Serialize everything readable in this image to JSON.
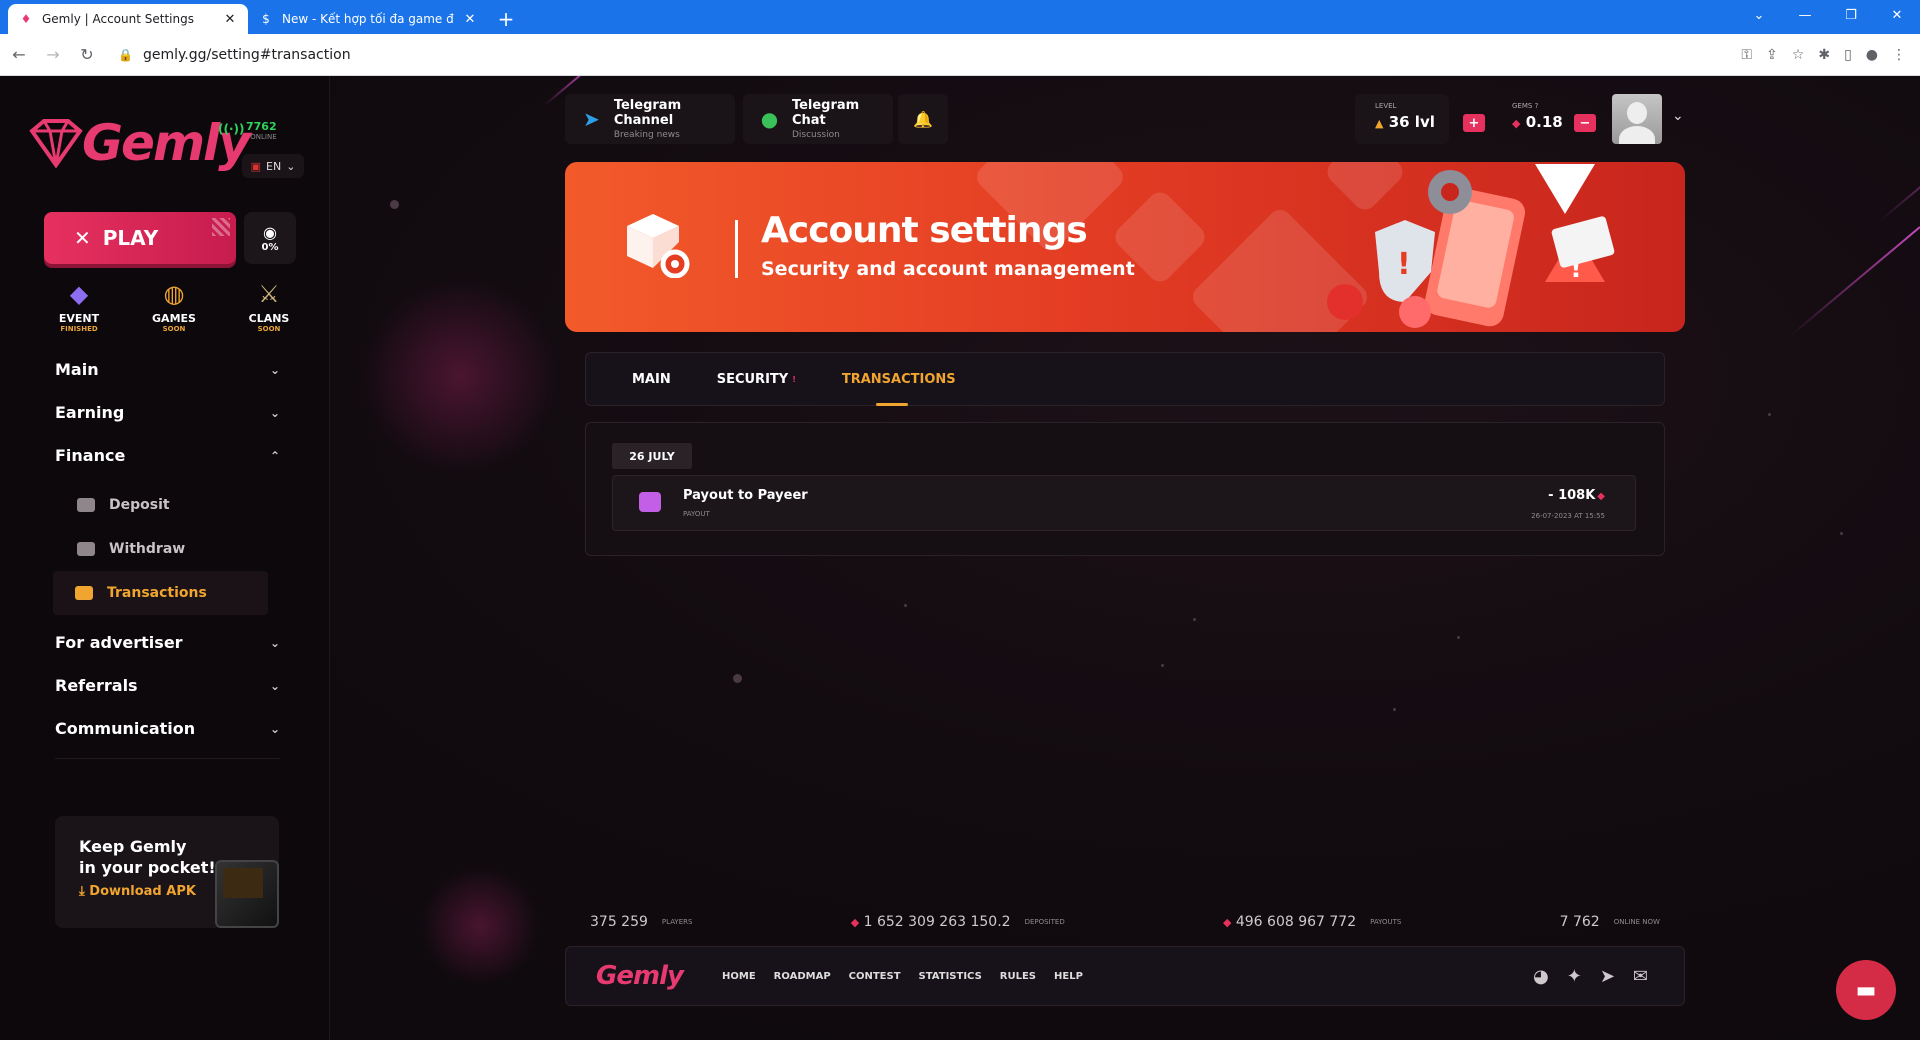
{
  "browser": {
    "tabs": [
      {
        "title": "Gemly | Account Settings",
        "active": true
      },
      {
        "title": "New - Kết hợp tối đa game để ki...",
        "active": false
      }
    ],
    "url": "gemly.gg/setting#transaction"
  },
  "sidebar": {
    "brand": "Gemly",
    "online_count": "7762",
    "online_label": "ONLINE",
    "lang": "EN",
    "play_label": "PLAY",
    "eye_value": "0%",
    "quick": [
      {
        "title": "EVENT",
        "status": "FINISHED"
      },
      {
        "title": "GAMES",
        "status": "SOON"
      },
      {
        "title": "CLANS",
        "status": "SOON"
      }
    ],
    "menu": [
      {
        "label": "Main"
      },
      {
        "label": "Earning"
      },
      {
        "label": "Finance"
      },
      {
        "label": "For advertiser"
      },
      {
        "label": "Referrals"
      },
      {
        "label": "Communication"
      }
    ],
    "finance_sub": [
      {
        "label": "Deposit"
      },
      {
        "label": "Withdraw"
      },
      {
        "label": "Transactions"
      }
    ],
    "apk": {
      "line1": "Keep Gemly",
      "line2": "in your pocket!",
      "download": "Download APK"
    }
  },
  "topbar": {
    "telegram_channel": {
      "title": "Telegram Channel",
      "sub": "Breaking news"
    },
    "telegram_chat": {
      "title": "Telegram Chat",
      "sub": "Discussion"
    },
    "level_label": "LEVEL",
    "level_value": "36 lvl",
    "gems_label": "GEMS",
    "gems_value": "0.18"
  },
  "banner": {
    "title": "Account settings",
    "subtitle": "Security and account management"
  },
  "tabs": [
    {
      "label": "MAIN",
      "active": false
    },
    {
      "label": "SECURITY",
      "active": false
    },
    {
      "label": "TRANSACTIONS",
      "active": true
    }
  ],
  "transactions": {
    "date": "26 JULY",
    "items": [
      {
        "title": "Payout to Payeer",
        "type": "PAYOUT",
        "amount": "- 108K",
        "datetime": "26-07-2023 AT 15:55"
      }
    ]
  },
  "stats": [
    {
      "value": "375 259",
      "label": "PLAYERS"
    },
    {
      "value": "1 652 309 263 150.2",
      "label": "DEPOSITED"
    },
    {
      "value": "496 608 967 772",
      "label": "PAYOUTS"
    },
    {
      "value": "7 762",
      "label": "ONLINE NOW"
    }
  ],
  "footer": {
    "brand": "Gemly",
    "links": [
      "HOME",
      "ROADMAP",
      "CONTEST",
      "STATISTICS",
      "RULES",
      "HELP"
    ]
  },
  "colors": {
    "brand": "#e73a70",
    "accent": "#f0a530",
    "banner": "#e43d24",
    "browser": "#1a73e8"
  }
}
